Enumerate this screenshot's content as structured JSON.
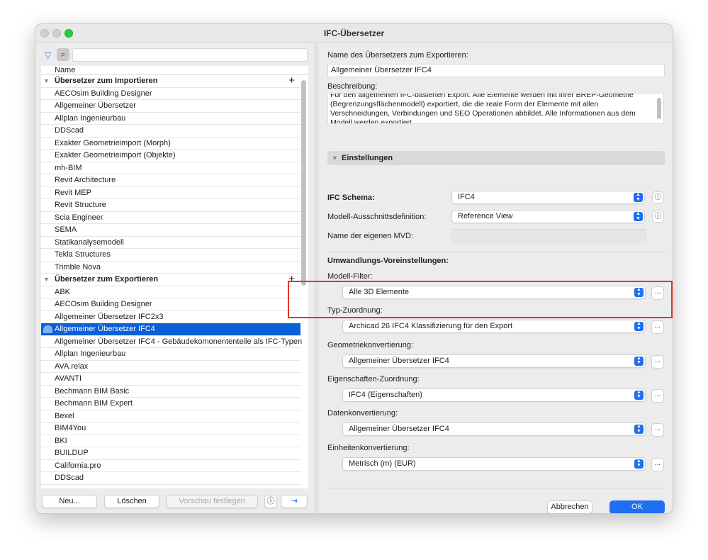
{
  "window": {
    "title": "IFC-Übersetzer"
  },
  "left": {
    "column_header": "Name",
    "import_section": "Übersetzer zum Importieren",
    "import_items": [
      "AECOsim Building Designer",
      "Allgemeiner Übersetzer",
      "Allplan Ingenieurbau",
      "DDScad",
      "Exakter Geometrieimport (Morph)",
      "Exakter Geometrieimport (Objekte)",
      "mh-BIM",
      "Revit Architecture",
      "Revit MEP",
      "Revit Structure",
      "Scia Engineer",
      "SEMA",
      "Statikanalysemodell",
      "Tekla Structures",
      "Trimble Nova"
    ],
    "export_section": "Übersetzer zum Exportieren",
    "export_items": [
      "ABK",
      "AECOsim Building Designer",
      "Allgemeiner Übersetzer IFC2x3",
      "Allgemeiner Übersetzer IFC4",
      "Allgemeiner Übersetzer IFC4 - Gebäudekomonententeile als IFC-Typen",
      "Allplan Ingenieurbau",
      "AVA.relax",
      "AVANTI",
      "Bechmann BIM Basic",
      "Bechmann BIM Expert",
      "Bexel",
      "BIM4You",
      "BKI",
      "BUILDUP",
      "California.pro",
      "DDScad"
    ],
    "selected_index": 3,
    "buttons": {
      "new": "Neu...",
      "delete": "Löschen",
      "preview": "Vorschau festlegen"
    }
  },
  "right": {
    "name_label": "Name des Übersetzers zum Exportieren:",
    "name_value": "Allgemeiner Übersetzer IFC4",
    "desc_label": "Beschreibung:",
    "desc_value": "Für den allgemeinen IFC-basierten Export. Alle Elemente werden mit ihrer BREP-Geometrie (Begrenzungsflächenmodell) exportiert, die die reale Form der Elemente mit allen Verschneidungen, Verbindungen und SEO Operationen abbildet. Alle Informationen aus dem Modell werden exportiert.",
    "settings_header": "Einstellungen",
    "schema_label": "IFC Schema:",
    "schema_value": "IFC4",
    "mvd_label": "Modell-Ausschnittsdefinition:",
    "mvd_value": "Reference View",
    "custom_mvd_label": "Name der eigenen MVD:",
    "conv_header": "Umwandlungs-Voreinstellungen:",
    "model_filter_label": "Modell-Filter:",
    "model_filter_value": "Alle 3D Elemente",
    "type_map_label": "Typ-Zuordnung:",
    "type_map_value": "Archicad 26 IFC4 Klassifizierung für den Export",
    "geom_label": "Geometriekonvertierung:",
    "geom_value": "Allgemeiner Übersetzer IFC4",
    "prop_label": "Eigenschaften-Zuordnung:",
    "prop_value": "IFC4 (Eigenschaften)",
    "data_label": "Datenkonvertierung:",
    "data_value": "Allgemeiner Übersetzer IFC4",
    "units_label": "Einheitenkonvertierung:",
    "units_value": "Metrisch (m) (EUR)",
    "ellipsis": "...",
    "cancel": "Abbrechen",
    "ok": "OK"
  },
  "colors": {
    "accent": "#0a60d8",
    "highlight": "#e8321f"
  }
}
